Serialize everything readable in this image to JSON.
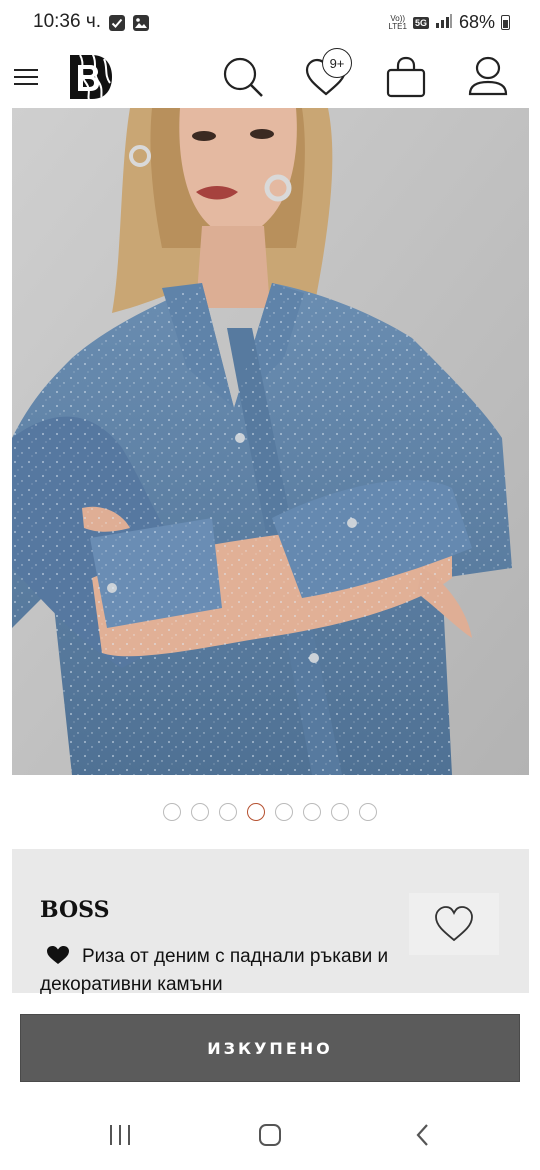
{
  "status_bar": {
    "time": "10:36 ч.",
    "network_top": "Vo))",
    "network_bottom": "LTE1",
    "network_5g": "5G",
    "battery": "68%",
    "icons": [
      "checkbox-icon",
      "image-icon",
      "signal-icon",
      "battery-icon"
    ]
  },
  "header": {
    "icons": [
      "menu-icon",
      "brand-logo",
      "search-icon",
      "heart-icon",
      "bag-icon",
      "user-icon"
    ],
    "wishlist_badge": "9+"
  },
  "product": {
    "image_icon": "product-photo-denim-shirt",
    "gallery": {
      "count": 8,
      "active_index": 3
    },
    "brand": "BOSS",
    "title": "Риза от деним с паднали ръкави и декоративни камъни",
    "favorite_icon": "heart-outline-icon"
  },
  "actions": {
    "sold_out_label": "ИЗКУПЕНО"
  },
  "nav_bar": {
    "icons": [
      "recents-icon",
      "home-icon",
      "back-icon"
    ]
  },
  "colors": {
    "active_dot": "#b5502f",
    "button_bg": "#5b5b5b",
    "card_bg": "#e9e9e9",
    "denim": "#5a7fa6"
  }
}
